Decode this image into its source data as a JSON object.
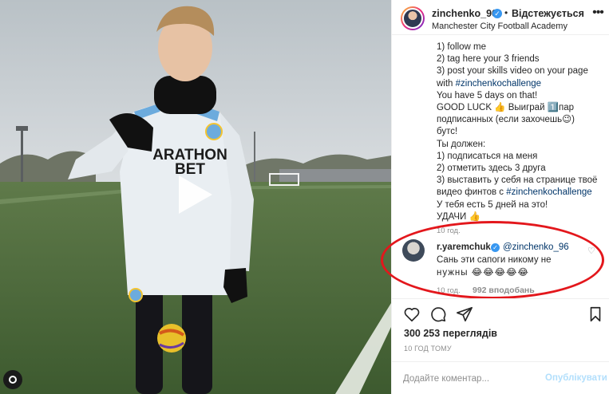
{
  "post": {
    "header": {
      "username": "zinchenko_96",
      "verified_mark": "✓",
      "separator": "•",
      "follow_status": "Відстежується",
      "location": "Manchester City Football Academy",
      "more_icon": "more-horizontal-icon"
    },
    "caption_lines": [
      "1) follow me",
      "2) tag here your 3 friends",
      "3) post your skills video on your page",
      "with #zinchenkochallenge",
      "You have 5 days on that!",
      "GOOD LUCK 👍 Выиграй 1️⃣пар",
      "подписанных (если захочешь😉)",
      "бутс!",
      "Ты должен:",
      "1) подписаться на меня",
      "2) отметить здесь 3 друга",
      "3) выставить у себя на странице твоё",
      "видео финтов с #zinchenkochallenge",
      "У тебя есть 5 дней на это!",
      "УДАЧИ 👍"
    ],
    "caption_time": "10 год.",
    "comment": {
      "user": "r.yaremchuk",
      "verified_mark": "✓",
      "mention": "@zinchenko_96",
      "text_line1": "Сань эти сапоги никому не",
      "text_line2": "нужны 😂😂😂😂😂",
      "time": "10 год.",
      "likes": "992 вподобань",
      "highlight_color": "#e3171c"
    },
    "actions": {
      "like_icon": "heart-icon",
      "comment_icon": "comment-icon",
      "share_icon": "share-icon",
      "save_icon": "bookmark-icon"
    },
    "views_count": "300 253",
    "views_label": "переглядів",
    "date": "10 ГОД ТОМУ",
    "add_comment": {
      "placeholder": "Додайте коментар...",
      "publish_label": "Опублікувати"
    }
  },
  "media": {
    "type": "video",
    "shirt_sponsor": "MARATHON BET",
    "play_icon": "play-icon",
    "reels_icon": "reels-icon"
  },
  "colors": {
    "accent": "#3897f0",
    "link": "#003569",
    "muted": "#8e8e8e",
    "publish_disabled": "#b2dffc"
  }
}
